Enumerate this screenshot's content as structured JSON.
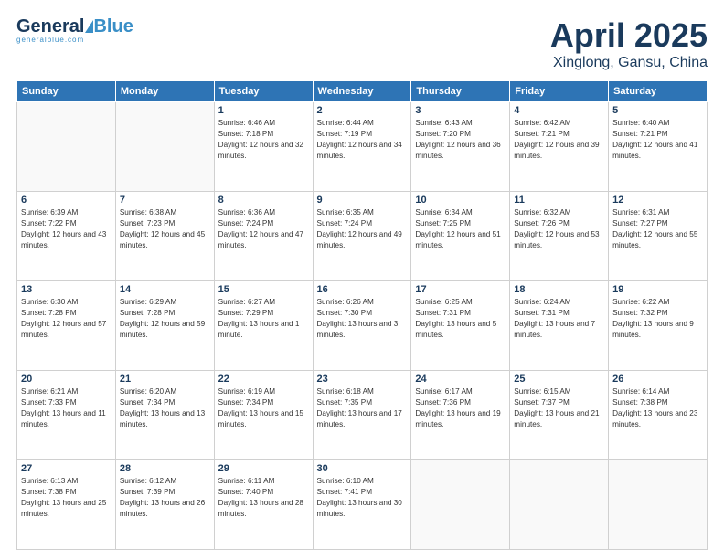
{
  "header": {
    "logo": {
      "general": "General",
      "blue": "Blue",
      "sub": "generalblue.com"
    },
    "title": "April 2025",
    "subtitle": "Xinglong, Gansu, China"
  },
  "calendar": {
    "days_of_week": [
      "Sunday",
      "Monday",
      "Tuesday",
      "Wednesday",
      "Thursday",
      "Friday",
      "Saturday"
    ],
    "weeks": [
      [
        {
          "day": "",
          "sunrise": "",
          "sunset": "",
          "daylight": ""
        },
        {
          "day": "",
          "sunrise": "",
          "sunset": "",
          "daylight": ""
        },
        {
          "day": "1",
          "sunrise": "Sunrise: 6:46 AM",
          "sunset": "Sunset: 7:18 PM",
          "daylight": "Daylight: 12 hours and 32 minutes."
        },
        {
          "day": "2",
          "sunrise": "Sunrise: 6:44 AM",
          "sunset": "Sunset: 7:19 PM",
          "daylight": "Daylight: 12 hours and 34 minutes."
        },
        {
          "day": "3",
          "sunrise": "Sunrise: 6:43 AM",
          "sunset": "Sunset: 7:20 PM",
          "daylight": "Daylight: 12 hours and 36 minutes."
        },
        {
          "day": "4",
          "sunrise": "Sunrise: 6:42 AM",
          "sunset": "Sunset: 7:21 PM",
          "daylight": "Daylight: 12 hours and 39 minutes."
        },
        {
          "day": "5",
          "sunrise": "Sunrise: 6:40 AM",
          "sunset": "Sunset: 7:21 PM",
          "daylight": "Daylight: 12 hours and 41 minutes."
        }
      ],
      [
        {
          "day": "6",
          "sunrise": "Sunrise: 6:39 AM",
          "sunset": "Sunset: 7:22 PM",
          "daylight": "Daylight: 12 hours and 43 minutes."
        },
        {
          "day": "7",
          "sunrise": "Sunrise: 6:38 AM",
          "sunset": "Sunset: 7:23 PM",
          "daylight": "Daylight: 12 hours and 45 minutes."
        },
        {
          "day": "8",
          "sunrise": "Sunrise: 6:36 AM",
          "sunset": "Sunset: 7:24 PM",
          "daylight": "Daylight: 12 hours and 47 minutes."
        },
        {
          "day": "9",
          "sunrise": "Sunrise: 6:35 AM",
          "sunset": "Sunset: 7:24 PM",
          "daylight": "Daylight: 12 hours and 49 minutes."
        },
        {
          "day": "10",
          "sunrise": "Sunrise: 6:34 AM",
          "sunset": "Sunset: 7:25 PM",
          "daylight": "Daylight: 12 hours and 51 minutes."
        },
        {
          "day": "11",
          "sunrise": "Sunrise: 6:32 AM",
          "sunset": "Sunset: 7:26 PM",
          "daylight": "Daylight: 12 hours and 53 minutes."
        },
        {
          "day": "12",
          "sunrise": "Sunrise: 6:31 AM",
          "sunset": "Sunset: 7:27 PM",
          "daylight": "Daylight: 12 hours and 55 minutes."
        }
      ],
      [
        {
          "day": "13",
          "sunrise": "Sunrise: 6:30 AM",
          "sunset": "Sunset: 7:28 PM",
          "daylight": "Daylight: 12 hours and 57 minutes."
        },
        {
          "day": "14",
          "sunrise": "Sunrise: 6:29 AM",
          "sunset": "Sunset: 7:28 PM",
          "daylight": "Daylight: 12 hours and 59 minutes."
        },
        {
          "day": "15",
          "sunrise": "Sunrise: 6:27 AM",
          "sunset": "Sunset: 7:29 PM",
          "daylight": "Daylight: 13 hours and 1 minute."
        },
        {
          "day": "16",
          "sunrise": "Sunrise: 6:26 AM",
          "sunset": "Sunset: 7:30 PM",
          "daylight": "Daylight: 13 hours and 3 minutes."
        },
        {
          "day": "17",
          "sunrise": "Sunrise: 6:25 AM",
          "sunset": "Sunset: 7:31 PM",
          "daylight": "Daylight: 13 hours and 5 minutes."
        },
        {
          "day": "18",
          "sunrise": "Sunrise: 6:24 AM",
          "sunset": "Sunset: 7:31 PM",
          "daylight": "Daylight: 13 hours and 7 minutes."
        },
        {
          "day": "19",
          "sunrise": "Sunrise: 6:22 AM",
          "sunset": "Sunset: 7:32 PM",
          "daylight": "Daylight: 13 hours and 9 minutes."
        }
      ],
      [
        {
          "day": "20",
          "sunrise": "Sunrise: 6:21 AM",
          "sunset": "Sunset: 7:33 PM",
          "daylight": "Daylight: 13 hours and 11 minutes."
        },
        {
          "day": "21",
          "sunrise": "Sunrise: 6:20 AM",
          "sunset": "Sunset: 7:34 PM",
          "daylight": "Daylight: 13 hours and 13 minutes."
        },
        {
          "day": "22",
          "sunrise": "Sunrise: 6:19 AM",
          "sunset": "Sunset: 7:34 PM",
          "daylight": "Daylight: 13 hours and 15 minutes."
        },
        {
          "day": "23",
          "sunrise": "Sunrise: 6:18 AM",
          "sunset": "Sunset: 7:35 PM",
          "daylight": "Daylight: 13 hours and 17 minutes."
        },
        {
          "day": "24",
          "sunrise": "Sunrise: 6:17 AM",
          "sunset": "Sunset: 7:36 PM",
          "daylight": "Daylight: 13 hours and 19 minutes."
        },
        {
          "day": "25",
          "sunrise": "Sunrise: 6:15 AM",
          "sunset": "Sunset: 7:37 PM",
          "daylight": "Daylight: 13 hours and 21 minutes."
        },
        {
          "day": "26",
          "sunrise": "Sunrise: 6:14 AM",
          "sunset": "Sunset: 7:38 PM",
          "daylight": "Daylight: 13 hours and 23 minutes."
        }
      ],
      [
        {
          "day": "27",
          "sunrise": "Sunrise: 6:13 AM",
          "sunset": "Sunset: 7:38 PM",
          "daylight": "Daylight: 13 hours and 25 minutes."
        },
        {
          "day": "28",
          "sunrise": "Sunrise: 6:12 AM",
          "sunset": "Sunset: 7:39 PM",
          "daylight": "Daylight: 13 hours and 26 minutes."
        },
        {
          "day": "29",
          "sunrise": "Sunrise: 6:11 AM",
          "sunset": "Sunset: 7:40 PM",
          "daylight": "Daylight: 13 hours and 28 minutes."
        },
        {
          "day": "30",
          "sunrise": "Sunrise: 6:10 AM",
          "sunset": "Sunset: 7:41 PM",
          "daylight": "Daylight: 13 hours and 30 minutes."
        },
        {
          "day": "",
          "sunrise": "",
          "sunset": "",
          "daylight": ""
        },
        {
          "day": "",
          "sunrise": "",
          "sunset": "",
          "daylight": ""
        },
        {
          "day": "",
          "sunrise": "",
          "sunset": "",
          "daylight": ""
        }
      ]
    ]
  }
}
